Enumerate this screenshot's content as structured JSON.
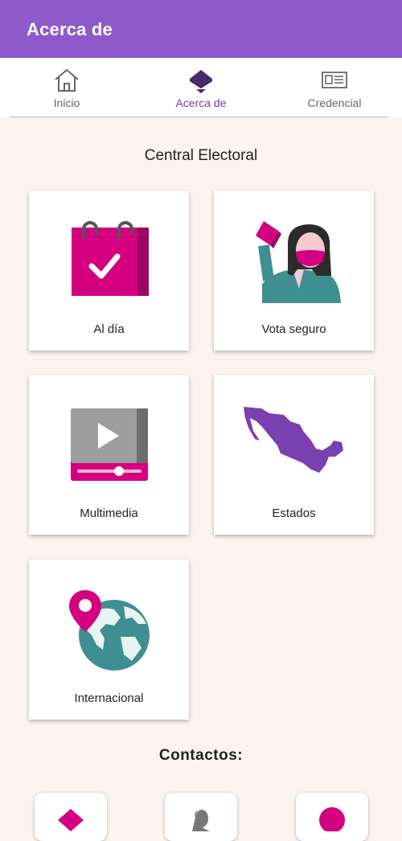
{
  "appbar": {
    "title": "Acerca de"
  },
  "tabs": [
    {
      "label": "Inicio",
      "icon": "home-icon",
      "active": false
    },
    {
      "label": "Acerca de",
      "icon": "ballot-box-icon",
      "active": true
    },
    {
      "label": "Credencial",
      "icon": "id-card-icon",
      "active": false
    }
  ],
  "central": {
    "title": "Central Electoral",
    "cards": [
      {
        "label": "Al día",
        "icon": "calendar-check-icon"
      },
      {
        "label": "Vota seguro",
        "icon": "voter-with-mask-icon"
      },
      {
        "label": "Multimedia",
        "icon": "video-player-icon"
      },
      {
        "label": "Estados",
        "icon": "mexico-map-icon"
      },
      {
        "label": "Internacional",
        "icon": "globe-pin-icon"
      }
    ]
  },
  "contacts": {
    "title": "Contactos:",
    "items": [
      {
        "icon": "ballot-box-icon"
      },
      {
        "icon": "phone-icon"
      },
      {
        "icon": "location-pin-icon"
      }
    ]
  },
  "colors": {
    "appbar": "#8e59c9",
    "accent": "#6f3ea6",
    "magenta": "#d5007f",
    "background": "#fdf3f1",
    "teal": "#3f8f92"
  }
}
